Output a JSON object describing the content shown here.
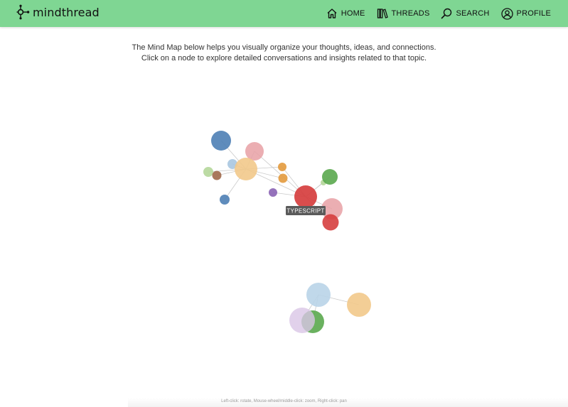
{
  "header": {
    "logo_text": "mindthread",
    "logo_icon": "graph-node-icon",
    "nav": [
      {
        "label": "HOME",
        "icon": "home-icon"
      },
      {
        "label": "THREADS",
        "icon": "books-icon"
      },
      {
        "label": "SEARCH",
        "icon": "search-icon"
      },
      {
        "label": "PROFILE",
        "icon": "user-circle-icon"
      }
    ],
    "background_color": "#7fd693"
  },
  "intro": {
    "line1": "The Mind Map below helps you visually organize your thoughts, ideas, and connections.",
    "line2": "Click on a node to explore detailed conversations and insights related to that topic."
  },
  "mind_map": {
    "hovered_node_label": "TYPESCRIPT",
    "node_colors": [
      "#4e7fb5",
      "#e8a0a4",
      "#f2c98b",
      "#a9c7e0",
      "#9ccb84",
      "#a0694a",
      "#e39a3d",
      "#8a63b4",
      "#d63e3e",
      "#5aa84e",
      "#d9c6e6"
    ]
  },
  "footer": {
    "hint": "Left-click: rotate, Mouse-wheel/middle-click: zoom, Right-click: pan"
  }
}
